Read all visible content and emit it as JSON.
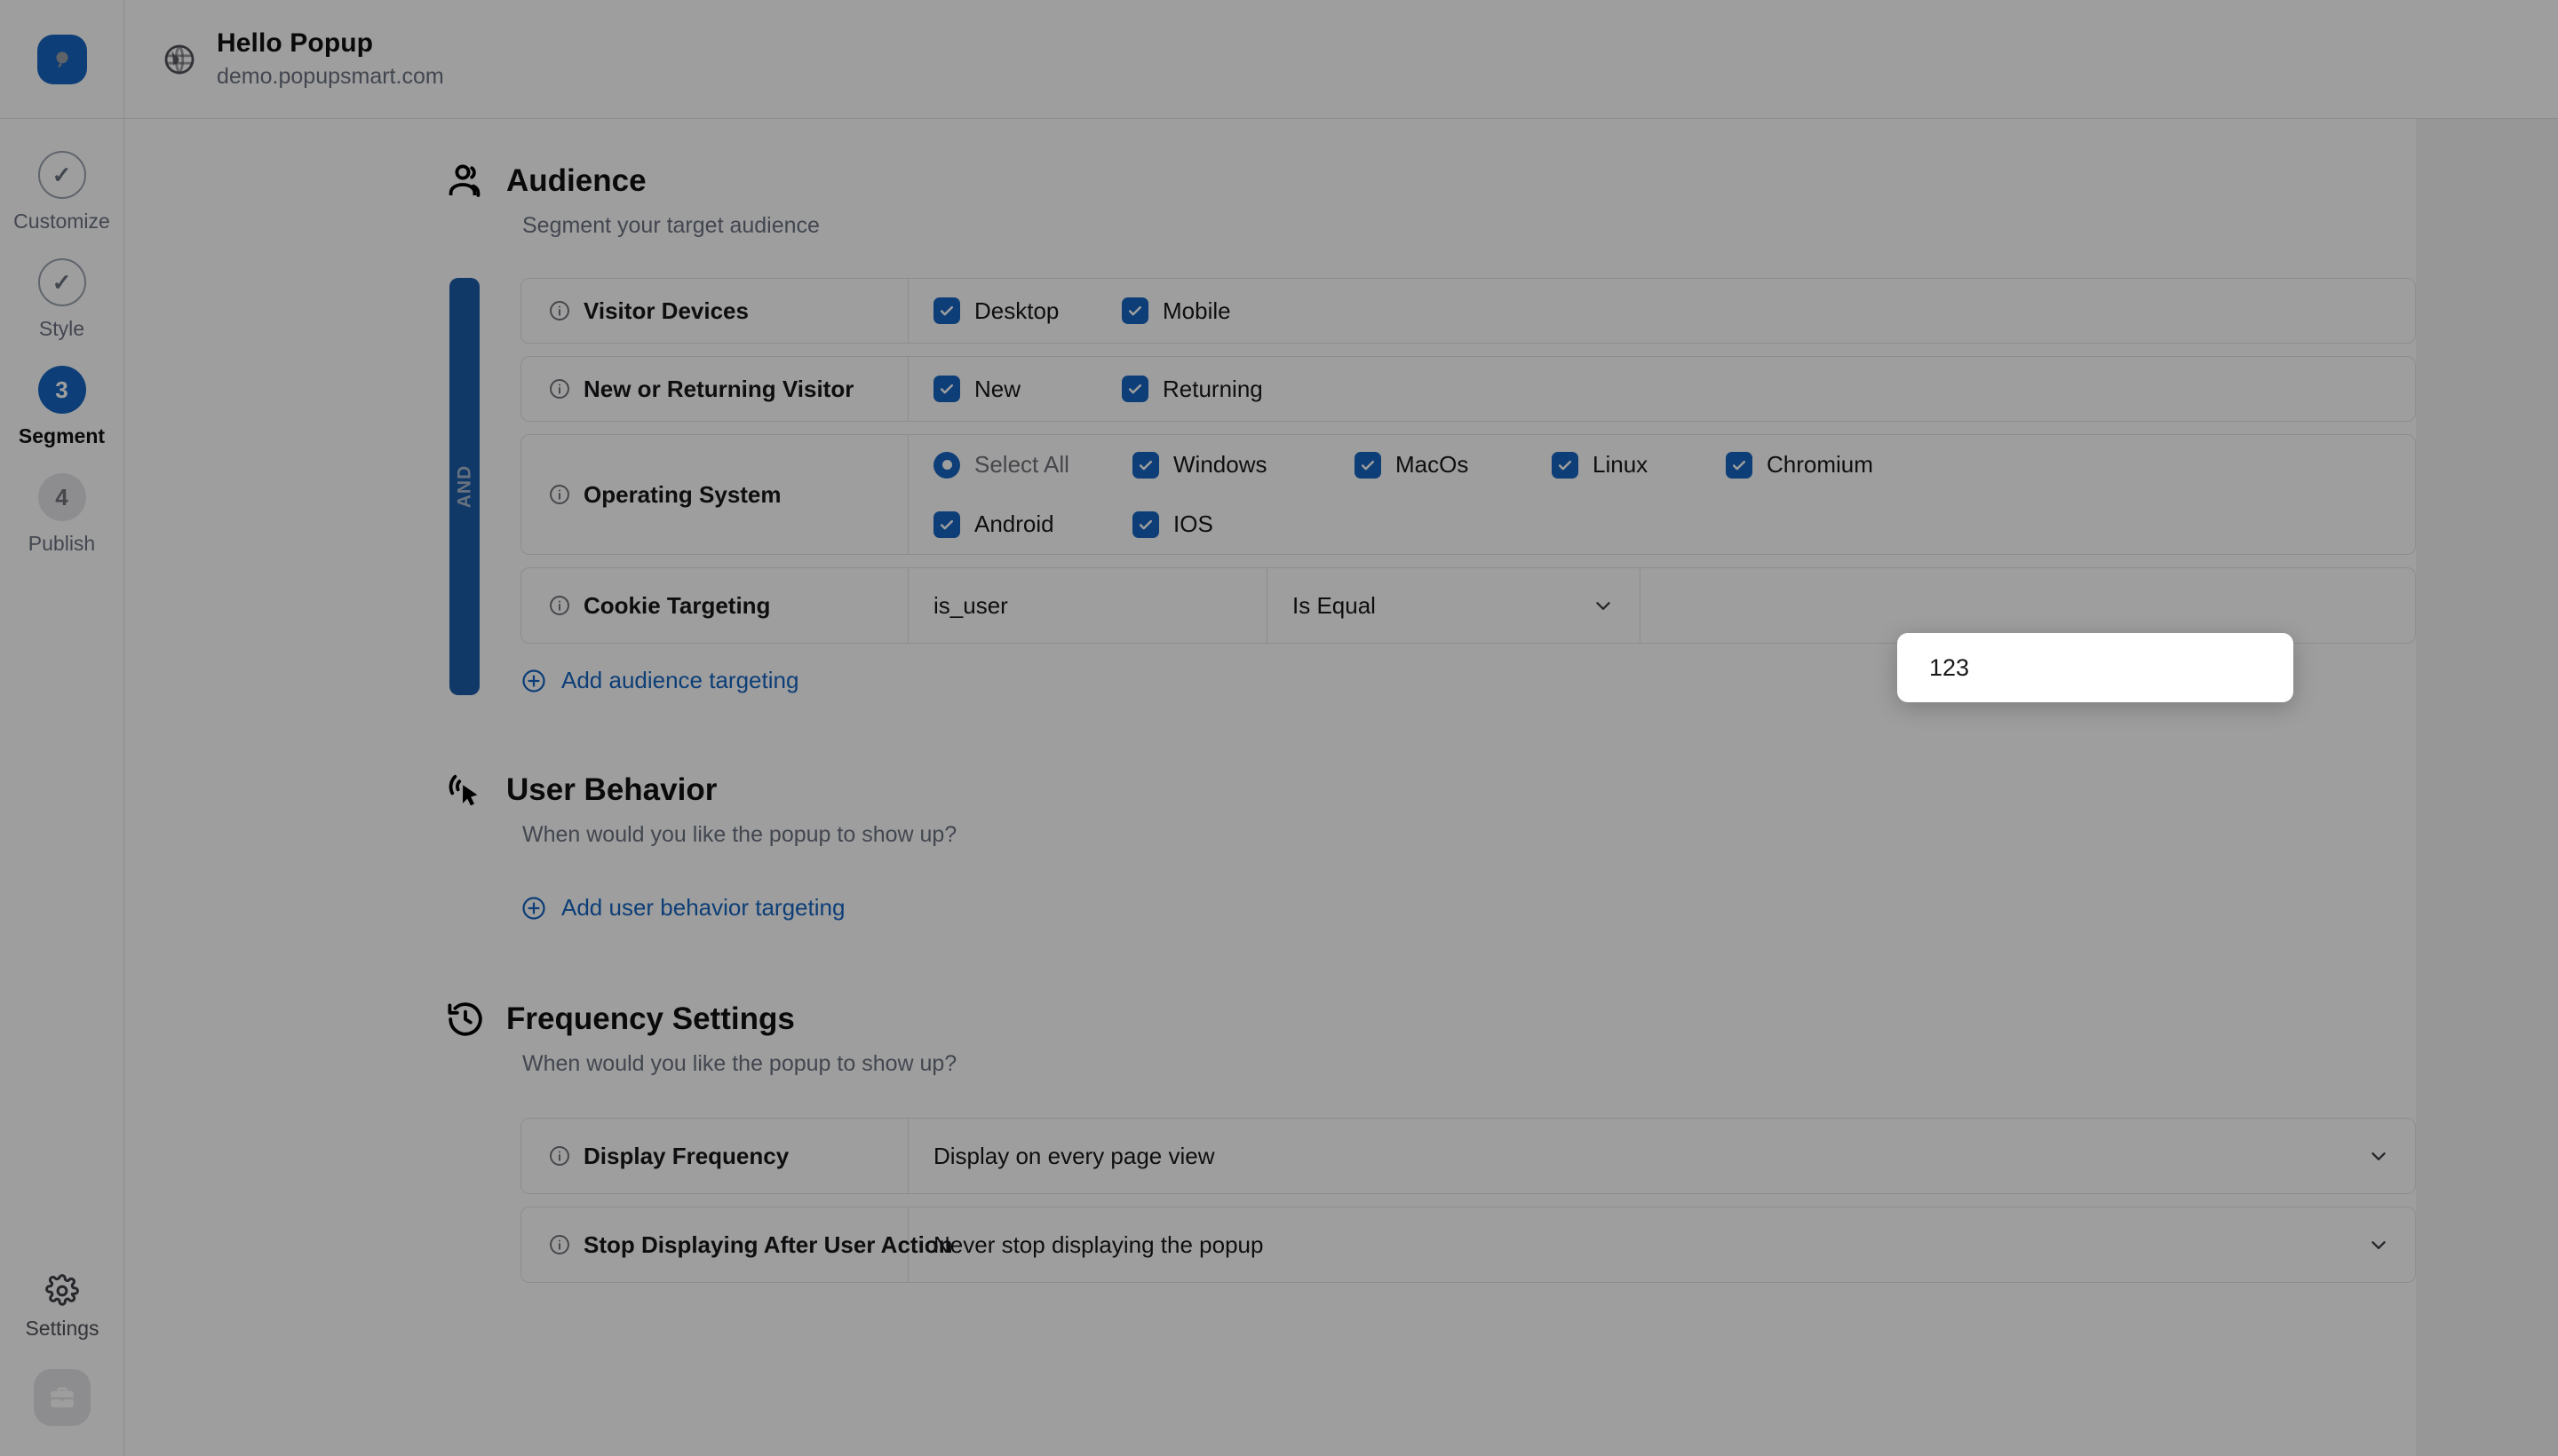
{
  "app": {
    "logo_icon": "popupsmart-logo-icon",
    "site_icon": "globe-icon",
    "site_title": "Hello Popup",
    "site_url": "demo.popupsmart.com"
  },
  "rail": {
    "steps": [
      {
        "badge": "✓",
        "label": "Customize",
        "state": "done"
      },
      {
        "badge": "✓",
        "label": "Style",
        "state": "done"
      },
      {
        "badge": "3",
        "label": "Segment",
        "state": "active"
      },
      {
        "badge": "4",
        "label": "Publish",
        "state": "todo"
      }
    ],
    "settings_label": "Settings",
    "settings_icon": "gear-icon",
    "workspace_icon": "briefcase-icon"
  },
  "sections": {
    "audience": {
      "icon": "audience-people-icon",
      "title": "Audience",
      "subtitle": "Segment your target audience",
      "operator": "AND",
      "add_link": "Add audience targeting",
      "add_link_icon": "plus-circle-icon",
      "rules": [
        {
          "name": "Visitor Devices",
          "type": "checkboxes",
          "options": [
            {
              "label": "Desktop",
              "checked": true,
              "control": "checkbox"
            },
            {
              "label": "Mobile",
              "checked": true,
              "control": "checkbox"
            }
          ]
        },
        {
          "name": "New or Returning Visitor",
          "type": "checkboxes",
          "options": [
            {
              "label": "New",
              "checked": true,
              "control": "checkbox"
            },
            {
              "label": "Returning",
              "checked": true,
              "control": "checkbox"
            }
          ]
        },
        {
          "name": "Operating System",
          "type": "checkboxes",
          "options": [
            {
              "label": "Select All",
              "checked": false,
              "control": "radio",
              "muted": true
            },
            {
              "label": "Windows",
              "checked": true,
              "control": "checkbox"
            },
            {
              "label": "MacOs",
              "checked": true,
              "control": "checkbox"
            },
            {
              "label": "Linux",
              "checked": true,
              "control": "checkbox"
            },
            {
              "label": "Chromium",
              "checked": true,
              "control": "checkbox"
            },
            {
              "label": "Android",
              "checked": true,
              "control": "checkbox"
            },
            {
              "label": "IOS",
              "checked": true,
              "control": "checkbox"
            }
          ]
        },
        {
          "name": "Cookie Targeting",
          "type": "cookie",
          "key": "is_user",
          "operator": "Is Equal",
          "value": "123"
        }
      ]
    },
    "user_behavior": {
      "icon": "cursor-click-icon",
      "title": "User Behavior",
      "subtitle": "When would you like the popup to show up?",
      "add_link": "Add user behavior targeting",
      "add_link_icon": "plus-circle-icon"
    },
    "frequency": {
      "icon": "history-clock-icon",
      "title": "Frequency Settings",
      "subtitle": "When would you like the popup to show up?",
      "rules": [
        {
          "name": "Display Frequency",
          "value": "Display on every page view"
        },
        {
          "name": "Stop Displaying After User Action",
          "value": "Never stop displaying the popup"
        }
      ]
    }
  },
  "focused_field": {
    "name": "cookie-value-input",
    "value": "123"
  },
  "colors": {
    "accent": "#1565c0",
    "and_bar": "#1c5da8",
    "link": "#1565c0",
    "scrim": "rgba(0,0,0,0.38)"
  }
}
